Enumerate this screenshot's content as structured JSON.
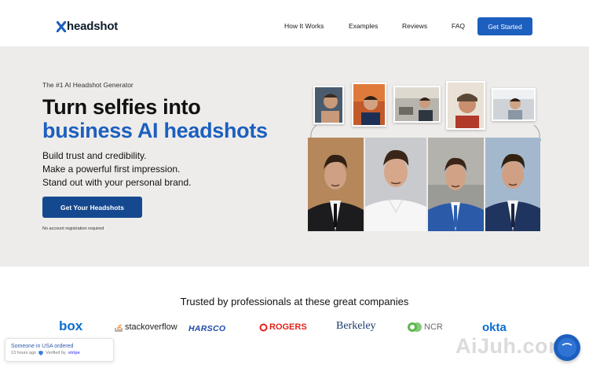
{
  "nav": {
    "logo_text": "headshot",
    "links": [
      "How It Works",
      "Examples",
      "Reviews",
      "FAQ"
    ],
    "cta": "Get Started"
  },
  "hero": {
    "eyebrow": "The #1 AI Headshot Generator",
    "headline_line1": "Turn selfies into",
    "headline_line2": "business AI headshots",
    "sub_lines": [
      "Build trust and credibility.",
      "Make a powerful first impression.",
      "Stand out with your personal brand."
    ],
    "cta": "Get Your Headshots",
    "note": "No account registration required"
  },
  "trusted": {
    "title": "Trusted by professionals at these great companies",
    "brands": [
      "box",
      "stackoverflow",
      "HARSCO",
      "ROGERS",
      "Berkeley",
      "NCR",
      "okta"
    ]
  },
  "toast": {
    "title": "Someone in USA ordered",
    "time": "13 hours ago",
    "verified": "Verified by",
    "verifier": "stripe"
  },
  "watermark": "AiJuh.com",
  "colors": {
    "accent": "#1c5fbf",
    "hero_bg": "#eeecea",
    "cta_dark": "#15498f"
  }
}
